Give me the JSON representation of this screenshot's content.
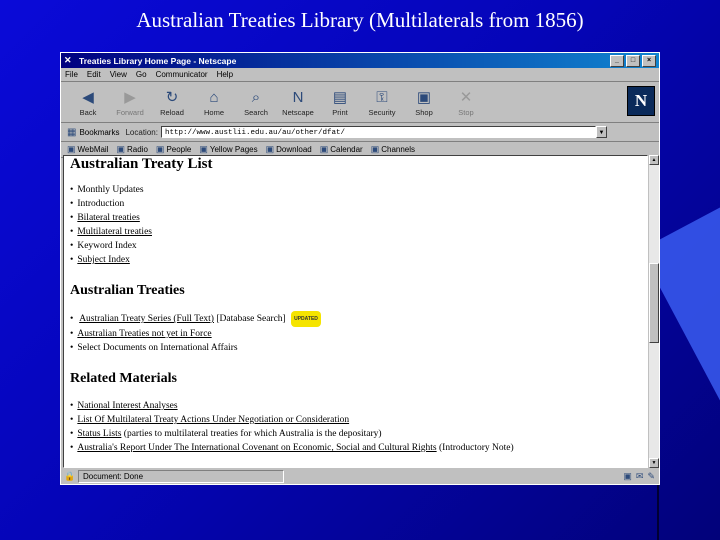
{
  "slide": {
    "title": "Australian Treaties Library (Multilaterals from 1856)"
  },
  "window": {
    "title": "Treaties Library Home Page - Netscape",
    "menu": [
      "File",
      "Edit",
      "View",
      "Go",
      "Communicator",
      "Help"
    ],
    "toolbar": [
      {
        "label": "Back",
        "icon": "back-arrow-icon",
        "glyph": "◀"
      },
      {
        "label": "Forward",
        "icon": "forward-arrow-icon",
        "glyph": "▶"
      },
      {
        "label": "Reload",
        "icon": "reload-icon",
        "glyph": "↻"
      },
      {
        "label": "Home",
        "icon": "home-icon",
        "glyph": "⌂"
      },
      {
        "label": "Search",
        "icon": "search-icon",
        "glyph": "⌕"
      },
      {
        "label": "Netscape",
        "icon": "netscape-icon",
        "glyph": "N"
      },
      {
        "label": "Print",
        "icon": "print-icon",
        "glyph": "▤"
      },
      {
        "label": "Security",
        "icon": "security-icon",
        "glyph": "⚿"
      },
      {
        "label": "Shop",
        "icon": "shop-icon",
        "glyph": "▣"
      },
      {
        "label": "Stop",
        "icon": "stop-icon",
        "glyph": "✕"
      }
    ],
    "bookmarks_label": "Bookmarks",
    "location_label": "Location:",
    "location_value": "http://www.austlii.edu.au/au/other/dfat/",
    "links": [
      "WebMail",
      "Radio",
      "People",
      "Yellow Pages",
      "Download",
      "Calendar",
      "Channels"
    ],
    "status": "Document: Done"
  },
  "page": {
    "h1": "Australian Treaty List",
    "list1": [
      "Monthly Updates",
      "Introduction",
      "Bilateral treaties",
      "Multilateral treaties",
      "Keyword Index",
      "Subject Index"
    ],
    "h2": "Australian Treaties",
    "list2": {
      "item1_link1": "Australian Treaty Series (Full Text)",
      "item1_link2": "[Database Search]",
      "item1_badge": "UPDATED",
      "item2": "Australian Treaties not yet in Force",
      "item3": "Select Documents on International Affairs"
    },
    "h3": "Related Materials",
    "list3": {
      "item1": "National Interest Analyses",
      "item2": "List Of Multilateral Treaty Actions Under Negotiation or Consideration",
      "item3_link": "Status Lists",
      "item3_text": " (parties to multilateral treaties for which Australia is the depositary)",
      "item4_link": "Australia's Report Under The International Covenant on Economic, Social and Cultural Rights",
      "item4_text": " (Introductory Note)"
    }
  }
}
